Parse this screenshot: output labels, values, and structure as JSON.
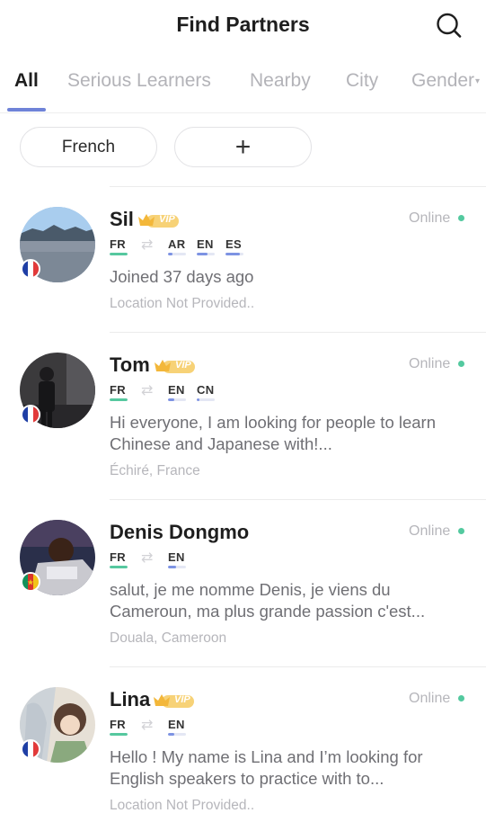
{
  "header": {
    "title": "Find Partners"
  },
  "tabs": [
    "All",
    "Serious Learners",
    "Nearby",
    "City",
    "Gender"
  ],
  "filters": {
    "language": "French",
    "add": "+"
  },
  "colors": {
    "accent": "#6f83d8",
    "native_bar": "#56c89f",
    "learning_bar": "#7d93e3",
    "online_dot": "#53c99f",
    "vip_gold": "#f3b73a"
  },
  "users": [
    {
      "name": "Sil",
      "vip": "VIP",
      "status": "Online",
      "native": "FR",
      "learning": [
        "AR",
        "EN",
        "ES"
      ],
      "learning_levels": [
        0.25,
        0.6,
        0.8
      ],
      "bio": "Joined 37 days ago",
      "location": "Location Not Provided..",
      "flag": "france"
    },
    {
      "name": "Tom",
      "vip": "VIP",
      "status": "Online",
      "native": "FR",
      "learning": [
        "EN",
        "CN"
      ],
      "learning_levels": [
        0.35,
        0.15
      ],
      "bio": "Hi everyone, I am looking for people to learn Chinese and Japanese with!...",
      "location": "Échiré, France",
      "flag": "france"
    },
    {
      "name": "Denis Dongmo",
      "vip": "",
      "status": "Online",
      "native": "FR",
      "learning": [
        "EN"
      ],
      "learning_levels": [
        0.45
      ],
      "bio": "salut, je me nomme Denis, je viens du Cameroun, ma plus grande passion c'est...",
      "location": "Douala, Cameroon",
      "flag": "cameroon"
    },
    {
      "name": "Lina",
      "vip": "VIP",
      "status": "Online",
      "native": "FR",
      "learning": [
        "EN"
      ],
      "learning_levels": [
        0.35
      ],
      "bio": "Hello ! My name is Lina and I’m looking for English speakers to practice with to...",
      "location": "Location Not Provided..",
      "flag": "france"
    }
  ]
}
